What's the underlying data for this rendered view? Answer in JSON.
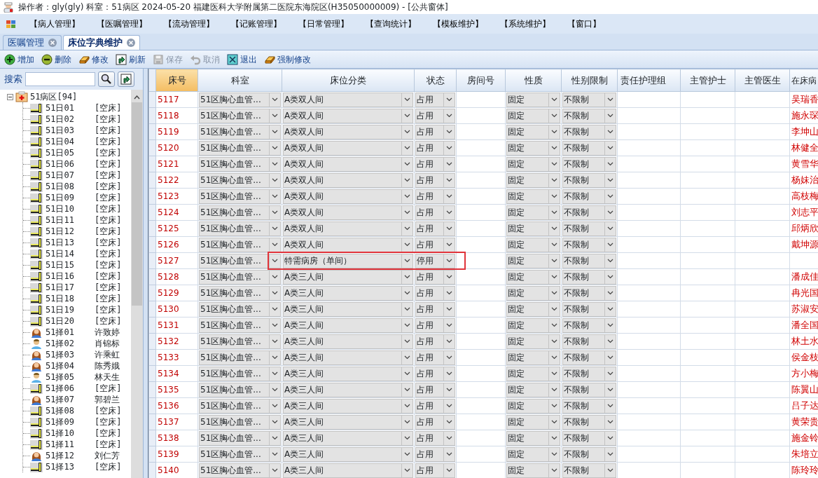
{
  "window": {
    "title": "操作者：gly(gly)  科室：51病区  2024-05-20  福建医科大学附属第二医院东海院区(H35050000009) - [公共窗体]"
  },
  "menu": [
    "【病人管理】",
    "【医嘱管理】",
    "【流动管理】",
    "【记账管理】",
    "【日常管理】",
    "【查询统计】",
    "【模板维护】",
    "【系统维护】",
    "【窗口】"
  ],
  "tabs": [
    {
      "label": "医嘱管理",
      "selected": false
    },
    {
      "label": "床位字典维护",
      "selected": true
    }
  ],
  "toolbar": [
    {
      "label": "增加",
      "kind": "add",
      "disabled": false
    },
    {
      "label": "删除",
      "kind": "delete",
      "disabled": false
    },
    {
      "label": "修改",
      "kind": "edit",
      "disabled": false
    },
    {
      "label": "刷新",
      "kind": "refresh",
      "disabled": false
    },
    {
      "label": "保存",
      "kind": "save",
      "disabled": true
    },
    {
      "label": "取消",
      "kind": "undo",
      "disabled": true
    },
    {
      "label": "退出",
      "kind": "exit",
      "disabled": false
    },
    {
      "label": "强制修改",
      "kind": "edit",
      "disabled": false
    }
  ],
  "search": {
    "label": "搜索"
  },
  "tree": {
    "label": "51病区[94]",
    "expanded": true,
    "children": [
      {
        "label": "51日01",
        "info": "[空床]",
        "kind": "bed"
      },
      {
        "label": "51日02",
        "info": "[空床]",
        "kind": "bed"
      },
      {
        "label": "51日03",
        "info": "[空床]",
        "kind": "bed"
      },
      {
        "label": "51日04",
        "info": "[空床]",
        "kind": "bed"
      },
      {
        "label": "51日05",
        "info": "[空床]",
        "kind": "bed"
      },
      {
        "label": "51日06",
        "info": "[空床]",
        "kind": "bed"
      },
      {
        "label": "51日07",
        "info": "[空床]",
        "kind": "bed"
      },
      {
        "label": "51日08",
        "info": "[空床]",
        "kind": "bed"
      },
      {
        "label": "51日09",
        "info": "[空床]",
        "kind": "bed"
      },
      {
        "label": "51日10",
        "info": "[空床]",
        "kind": "bed"
      },
      {
        "label": "51日11",
        "info": "[空床]",
        "kind": "bed"
      },
      {
        "label": "51日12",
        "info": "[空床]",
        "kind": "bed"
      },
      {
        "label": "51日13",
        "info": "[空床]",
        "kind": "bed"
      },
      {
        "label": "51日14",
        "info": "[空床]",
        "kind": "bed"
      },
      {
        "label": "51日15",
        "info": "[空床]",
        "kind": "bed"
      },
      {
        "label": "51日16",
        "info": "[空床]",
        "kind": "bed"
      },
      {
        "label": "51日17",
        "info": "[空床]",
        "kind": "bed"
      },
      {
        "label": "51日18",
        "info": "[空床]",
        "kind": "bed"
      },
      {
        "label": "51日19",
        "info": "[空床]",
        "kind": "bed"
      },
      {
        "label": "51日20",
        "info": "[空床]",
        "kind": "bed"
      },
      {
        "label": "51择01",
        "info": "许致婷",
        "kind": "female"
      },
      {
        "label": "51择02",
        "info": "肖锦标",
        "kind": "male"
      },
      {
        "label": "51择03",
        "info": "许乘虹",
        "kind": "female"
      },
      {
        "label": "51择04",
        "info": "陈秀娥",
        "kind": "female"
      },
      {
        "label": "51择05",
        "info": "林天生",
        "kind": "male"
      },
      {
        "label": "51择06",
        "info": "[空床]",
        "kind": "bed"
      },
      {
        "label": "51择07",
        "info": "郭碧兰",
        "kind": "female"
      },
      {
        "label": "51择08",
        "info": "[空床]",
        "kind": "bed"
      },
      {
        "label": "51择09",
        "info": "[空床]",
        "kind": "bed"
      },
      {
        "label": "51择10",
        "info": "[空床]",
        "kind": "bed"
      },
      {
        "label": "51择11",
        "info": "[空床]",
        "kind": "bed"
      },
      {
        "label": "51择12",
        "info": "刘仁芳",
        "kind": "female"
      },
      {
        "label": "51择13",
        "info": "[空床]",
        "kind": "bed"
      }
    ]
  },
  "table": {
    "columns": [
      {
        "label": "床号",
        "selected": true
      },
      {
        "label": "科室",
        "selected": false
      },
      {
        "label": "床位分类",
        "selected": false
      },
      {
        "label": "状态",
        "selected": false
      },
      {
        "label": "房间号",
        "selected": false
      },
      {
        "label": "性质",
        "selected": false
      },
      {
        "label": "性别限制",
        "selected": false
      },
      {
        "label": "责任护理组",
        "selected": false
      },
      {
        "label": "主管护士",
        "selected": false
      },
      {
        "label": "主管医生",
        "selected": false
      },
      {
        "label": "在床病",
        "selected": false
      }
    ],
    "rows": [
      {
        "bed": "5117",
        "dept": "51区胸心血管...",
        "category": "A类双人间",
        "status": "占用",
        "nature": "固定",
        "gender_limit": "不限制",
        "patient": "吴瑞香",
        "highlighted": false
      },
      {
        "bed": "5118",
        "dept": "51区胸心血管...",
        "category": "A类双人间",
        "status": "占用",
        "nature": "固定",
        "gender_limit": "不限制",
        "patient": "施永琛",
        "highlighted": false
      },
      {
        "bed": "5119",
        "dept": "51区胸心血管...",
        "category": "A类双人间",
        "status": "占用",
        "nature": "固定",
        "gender_limit": "不限制",
        "patient": "李坤山",
        "highlighted": false
      },
      {
        "bed": "5120",
        "dept": "51区胸心血管...",
        "category": "A类双人间",
        "status": "占用",
        "nature": "固定",
        "gender_limit": "不限制",
        "patient": "林健全",
        "highlighted": false
      },
      {
        "bed": "5121",
        "dept": "51区胸心血管...",
        "category": "A类双人间",
        "status": "占用",
        "nature": "固定",
        "gender_limit": "不限制",
        "patient": "黄雪华",
        "highlighted": false
      },
      {
        "bed": "5122",
        "dept": "51区胸心血管...",
        "category": "A类双人间",
        "status": "占用",
        "nature": "固定",
        "gender_limit": "不限制",
        "patient": "杨妹治",
        "highlighted": false
      },
      {
        "bed": "5123",
        "dept": "51区胸心血管...",
        "category": "A类双人间",
        "status": "占用",
        "nature": "固定",
        "gender_limit": "不限制",
        "patient": "高枝梅",
        "highlighted": false
      },
      {
        "bed": "5124",
        "dept": "51区胸心血管...",
        "category": "A类双人间",
        "status": "占用",
        "nature": "固定",
        "gender_limit": "不限制",
        "patient": "刘志平",
        "highlighted": false
      },
      {
        "bed": "5125",
        "dept": "51区胸心血管...",
        "category": "A类双人间",
        "status": "占用",
        "nature": "固定",
        "gender_limit": "不限制",
        "patient": "邱炳欣",
        "highlighted": false
      },
      {
        "bed": "5126",
        "dept": "51区胸心血管...",
        "category": "A类双人间",
        "status": "占用",
        "nature": "固定",
        "gender_limit": "不限制",
        "patient": "戴坤源",
        "highlighted": false
      },
      {
        "bed": "5127",
        "dept": "51区胸心血管...",
        "category": "特需病房（单间）",
        "status": "停用",
        "nature": "固定",
        "gender_limit": "不限制",
        "highlighted": true
      },
      {
        "bed": "5128",
        "dept": "51区胸心血管...",
        "category": "A类三人间",
        "status": "占用",
        "nature": "固定",
        "gender_limit": "不限制",
        "patient": "潘成佳",
        "highlighted": false
      },
      {
        "bed": "5129",
        "dept": "51区胸心血管...",
        "category": "A类三人间",
        "status": "占用",
        "nature": "固定",
        "gender_limit": "不限制",
        "patient": "冉光国",
        "highlighted": false
      },
      {
        "bed": "5130",
        "dept": "51区胸心血管...",
        "category": "A类三人间",
        "status": "占用",
        "nature": "固定",
        "gender_limit": "不限制",
        "patient": "苏淑安",
        "highlighted": false
      },
      {
        "bed": "5131",
        "dept": "51区胸心血管...",
        "category": "A类三人间",
        "status": "占用",
        "nature": "固定",
        "gender_limit": "不限制",
        "patient": "潘全国",
        "highlighted": false
      },
      {
        "bed": "5132",
        "dept": "51区胸心血管...",
        "category": "A类三人间",
        "status": "占用",
        "nature": "固定",
        "gender_limit": "不限制",
        "patient": "林土水",
        "highlighted": false
      },
      {
        "bed": "5133",
        "dept": "51区胸心血管...",
        "category": "A类三人间",
        "status": "占用",
        "nature": "固定",
        "gender_limit": "不限制",
        "patient": "侯金枝",
        "highlighted": false
      },
      {
        "bed": "5134",
        "dept": "51区胸心血管...",
        "category": "A类三人间",
        "status": "占用",
        "nature": "固定",
        "gender_limit": "不限制",
        "patient": "方小梅",
        "highlighted": false
      },
      {
        "bed": "5135",
        "dept": "51区胸心血管...",
        "category": "A类三人间",
        "status": "占用",
        "nature": "固定",
        "gender_limit": "不限制",
        "patient": "陈翼山",
        "highlighted": false
      },
      {
        "bed": "5136",
        "dept": "51区胸心血管...",
        "category": "A类三人间",
        "status": "占用",
        "nature": "固定",
        "gender_limit": "不限制",
        "patient": "吕子达",
        "highlighted": false
      },
      {
        "bed": "5137",
        "dept": "51区胸心血管...",
        "category": "A类三人间",
        "status": "占用",
        "nature": "固定",
        "gender_limit": "不限制",
        "patient": "黄荣贵",
        "highlighted": false
      },
      {
        "bed": "5138",
        "dept": "51区胸心血管...",
        "category": "A类三人间",
        "status": "占用",
        "nature": "固定",
        "gender_limit": "不限制",
        "patient": "施金铃",
        "highlighted": false
      },
      {
        "bed": "5139",
        "dept": "51区胸心血管...",
        "category": "A类三人间",
        "status": "占用",
        "nature": "固定",
        "gender_limit": "不限制",
        "patient": "朱培立",
        "highlighted": false
      },
      {
        "bed": "5140",
        "dept": "51区胸心血管...",
        "category": "A类三人间",
        "status": "占用",
        "nature": "固定",
        "gender_limit": "不限制",
        "patient": "陈玲玲",
        "highlighted": false
      }
    ]
  }
}
